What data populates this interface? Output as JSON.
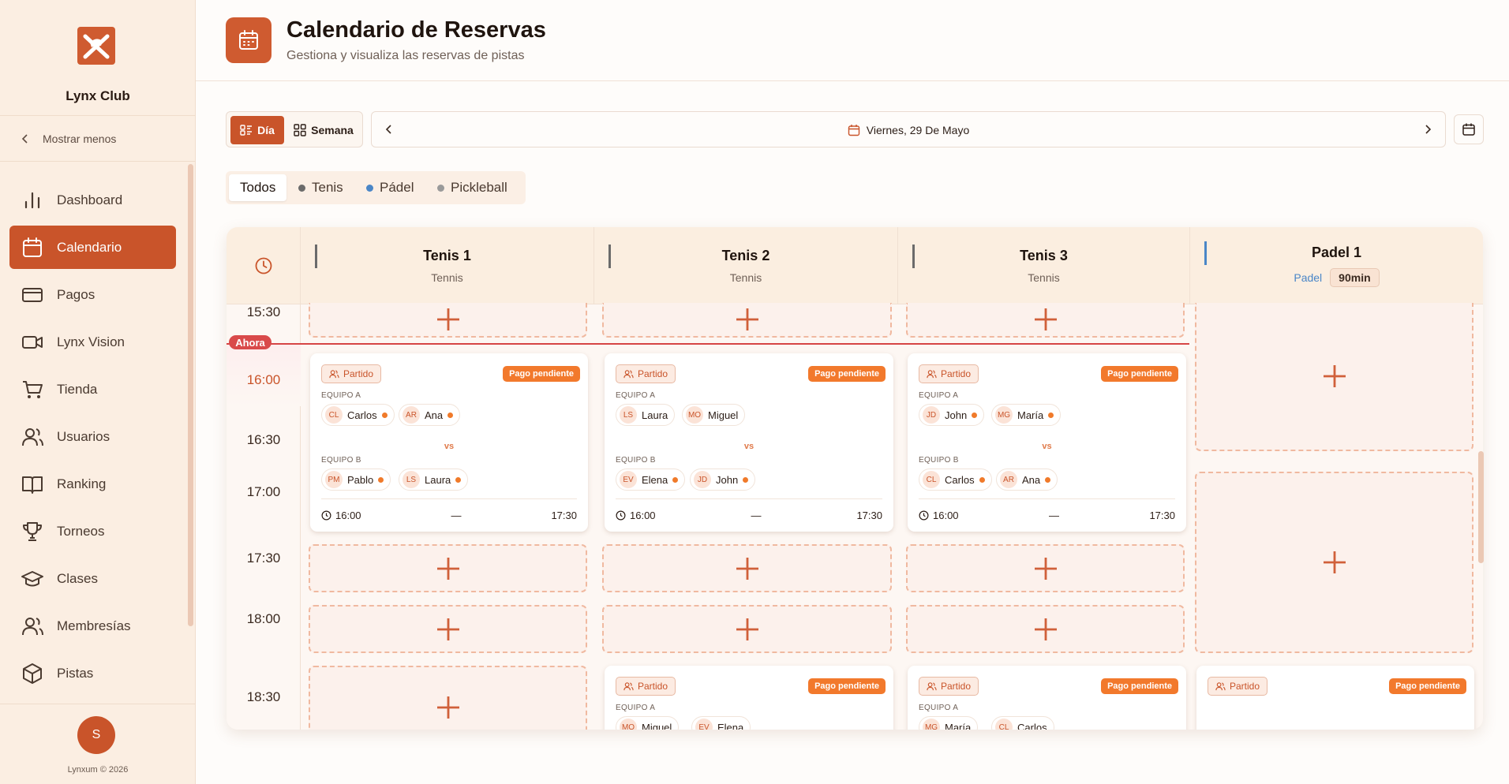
{
  "sidebar": {
    "club_name": "Lynx Club",
    "collapse_label": "Mostrar menos",
    "items": [
      {
        "label": "Dashboard",
        "icon": "bar-chart-icon"
      },
      {
        "label": "Calendario",
        "icon": "calendar-icon",
        "active": true
      },
      {
        "label": "Pagos",
        "icon": "credit-card-icon"
      },
      {
        "label": "Lynx Vision",
        "icon": "video-icon"
      },
      {
        "label": "Tienda",
        "icon": "cart-icon"
      },
      {
        "label": "Usuarios",
        "icon": "users-icon"
      },
      {
        "label": "Ranking",
        "icon": "book-icon"
      },
      {
        "label": "Torneos",
        "icon": "trophy-icon"
      },
      {
        "label": "Clases",
        "icon": "graduation-cap-icon"
      },
      {
        "label": "Membresías",
        "icon": "members-icon"
      },
      {
        "label": "Pistas",
        "icon": "box-icon"
      }
    ],
    "avatar_initial": "S",
    "copyright": "Lynxum © 2026"
  },
  "header": {
    "title": "Calendario de Reservas",
    "subtitle": "Gestiona y visualiza las reservas de pistas"
  },
  "toolbar": {
    "view_day": "Día",
    "view_week": "Semana",
    "date_label": "Viernes, 29 De Mayo"
  },
  "filters": {
    "all": "Todos",
    "tenis": "Tenis",
    "padel": "Pádel",
    "pickleball": "Pickleball",
    "colors": {
      "tenis": "#6b6b6b",
      "padel": "#4a86c7",
      "pickleball": "#9a9a9a"
    }
  },
  "calendar": {
    "now_label": "Ahora",
    "times": [
      "15:30",
      "16:00",
      "16:30",
      "17:00",
      "17:30",
      "18:00",
      "18:30"
    ],
    "courts": [
      {
        "name": "Tenis 1",
        "type": "Tennis",
        "color": "#6b6b6b"
      },
      {
        "name": "Tenis 2",
        "type": "Tennis",
        "color": "#6b6b6b"
      },
      {
        "name": "Tenis 3",
        "type": "Tennis",
        "color": "#6b6b6b"
      },
      {
        "name": "Padel 1",
        "type": "Padel",
        "duration": "90min",
        "color": "#4a86c7"
      }
    ],
    "labels": {
      "partido": "Partido",
      "pago": "Pago pendiente",
      "team_a": "EQUIPO A",
      "team_b": "EQUIPO B",
      "vs": "vs",
      "dash": "—"
    },
    "bookings": [
      {
        "team_a": [
          {
            "ini": "CL",
            "name": "Carlos"
          },
          {
            "ini": "AR",
            "name": "Ana"
          }
        ],
        "team_b": [
          {
            "ini": "PM",
            "name": "Pablo"
          },
          {
            "ini": "LS",
            "name": "Laura"
          }
        ],
        "start": "16:00",
        "end": "17:30"
      },
      {
        "team_a": [
          {
            "ini": "LS",
            "name": "Laura"
          },
          {
            "ini": "MO",
            "name": "Miguel"
          }
        ],
        "team_b": [
          {
            "ini": "EV",
            "name": "Elena"
          },
          {
            "ini": "JD",
            "name": "John"
          }
        ],
        "start": "16:00",
        "end": "17:30"
      },
      {
        "team_a": [
          {
            "ini": "JD",
            "name": "John"
          },
          {
            "ini": "MG",
            "name": "María"
          }
        ],
        "team_b": [
          {
            "ini": "CL",
            "name": "Carlos"
          },
          {
            "ini": "AR",
            "name": "Ana"
          }
        ],
        "start": "16:00",
        "end": "17:30"
      }
    ],
    "lower_bookings": [
      {
        "team_a": [
          {
            "ini": "MO",
            "name": "Miguel"
          },
          {
            "ini": "EV",
            "name": "Elena"
          }
        ]
      },
      {
        "team_a": [
          {
            "ini": "MG",
            "name": "María"
          },
          {
            "ini": "CL",
            "name": "Carlos"
          }
        ]
      }
    ]
  }
}
